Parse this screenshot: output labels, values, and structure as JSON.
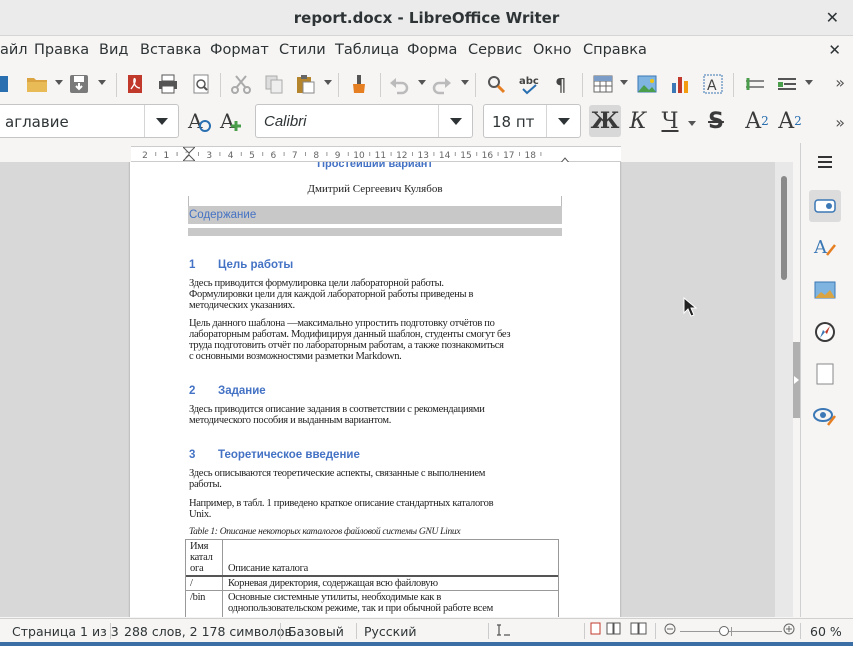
{
  "window": {
    "title": "report.docx - LibreOffice Writer"
  },
  "menu": [
    "айл",
    "Правка",
    "Вид",
    "Вставка",
    "Формат",
    "Стили",
    "Таблица",
    "Форма",
    "Сервис",
    "Окно",
    "Справка"
  ],
  "toolbar2": {
    "style_value": "аглавие",
    "font_value": "Calibri",
    "size_value": "18 пт"
  },
  "format_labels": {
    "bold": "Ж",
    "italic": "К",
    "underline": "Ч",
    "strike": "S",
    "super": "A",
    "sup_num": "2",
    "sub": "A",
    "sub_num": "2"
  },
  "ruler_ticks": [
    "2",
    "1",
    "1",
    "2",
    "3",
    "4",
    "5",
    "6",
    "7",
    "8",
    "9",
    "10",
    "11",
    "12",
    "13",
    "14",
    "15",
    "16",
    "17",
    "18"
  ],
  "document": {
    "top_partial": "Простейший вариант",
    "author": "Дмитрий Сергеевич Кулябов",
    "toc_heading": "Содержание",
    "s1_num": "1",
    "s1_title": "Цель работы",
    "s1_p1": [
      "Здесь приводится формулировка цели лабораторной работы.",
      "Формулировки цели для каждой лабораторной работы приведены в",
      "методических указаниях."
    ],
    "s1_p2": [
      "Цель данного шаблона —максимально упростить подготовку отчётов по",
      "лабораторным работам. Модифицируя данный шаблон, студенты смогут без",
      "труда подготовить отчёт по лабораторным работам, а также познакомиться",
      "с основными возможностями разметки Markdown."
    ],
    "s2_num": "2",
    "s2_title": "Задание",
    "s2_p1": [
      "Здесь приводится описание задания в соответствии с рекомендациями",
      "методического пособия и выданным вариантом."
    ],
    "s3_num": "3",
    "s3_title": "Теоретическое введение",
    "s3_p1": [
      "Здесь описываются теоретические аспекты, связанные с выполнением",
      "работы."
    ],
    "s3_p2": [
      "Например, в табл. 1 приведено краткое описание стандартных каталогов",
      "Unix."
    ],
    "table_caption": "Table 1: Описание некоторых каталогов файловой системы GNU Linux",
    "table_head": [
      "Имя",
      "катал",
      "ога"
    ],
    "table_head2": "Описание каталога",
    "rows": [
      {
        "name": "/",
        "desc": "Корневая директория, содержащая всю файловую"
      },
      {
        "name": "/bin",
        "desc": "Основные системные утилиты, необходимые как в"
      },
      {
        "name": "",
        "desc": "однопользовательском режиме, так и при обычной работе всем"
      }
    ]
  },
  "status": {
    "page": "Страница 1 из 3",
    "words": "288 слов, 2 178 символов",
    "style": "Базовый",
    "lang": "Русский",
    "zoom": "60 %"
  },
  "colors": {
    "heading": "#4472c4",
    "toc_bg": "#c8c8c8"
  }
}
